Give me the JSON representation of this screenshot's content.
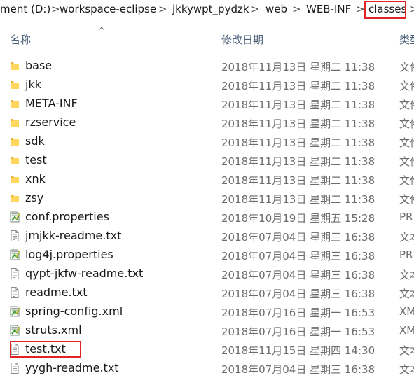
{
  "breadcrumb": [
    {
      "label": "ment (D:)"
    },
    {
      "label": "workspace-eclipse"
    },
    {
      "label": "jkkywpt_pydzk"
    },
    {
      "label": "web"
    },
    {
      "label": "WEB-INF"
    },
    {
      "label": "classes"
    }
  ],
  "breadcrumb_separator": ">",
  "columns": {
    "name": "名称",
    "date": "修改日期",
    "type": "类型",
    "sort_indicator": "^"
  },
  "highlight_color": "#e02424",
  "files": [
    {
      "name": "base",
      "modified": "2018年11月13日 星期二 11:38",
      "type": "文件",
      "icon": "folder-icon"
    },
    {
      "name": "jkk",
      "modified": "2018年11月13日 星期二 11:38",
      "type": "文件",
      "icon": "folder-icon"
    },
    {
      "name": "META-INF",
      "modified": "2018年11月13日 星期二 11:38",
      "type": "文件",
      "icon": "folder-icon"
    },
    {
      "name": "rzservice",
      "modified": "2018年11月13日 星期二 11:38",
      "type": "文件",
      "icon": "folder-icon"
    },
    {
      "name": "sdk",
      "modified": "2018年11月13日 星期二 11:38",
      "type": "文件",
      "icon": "folder-icon"
    },
    {
      "name": "test",
      "modified": "2018年11月13日 星期二 11:38",
      "type": "文件",
      "icon": "folder-icon"
    },
    {
      "name": "xnk",
      "modified": "2018年11月13日 星期二 11:38",
      "type": "文件",
      "icon": "folder-icon"
    },
    {
      "name": "zsy",
      "modified": "2018年11月13日 星期二 11:38",
      "type": "文件",
      "icon": "folder-icon"
    },
    {
      "name": "conf.properties",
      "modified": "2018年10月19日 星期五 15:28",
      "type": "PR",
      "icon": "config-file-icon"
    },
    {
      "name": "jmjkk-readme.txt",
      "modified": "2018年07月04日 星期三 16:38",
      "type": "文本",
      "icon": "text-file-icon"
    },
    {
      "name": "log4j.properties",
      "modified": "2018年07月04日 星期三 16:38",
      "type": "PR",
      "icon": "config-file-icon"
    },
    {
      "name": "qypt-jkfw-readme.txt",
      "modified": "2018年07月04日 星期三 16:38",
      "type": "文本",
      "icon": "text-file-icon"
    },
    {
      "name": "readme.txt",
      "modified": "2018年07月04日 星期三 16:38",
      "type": "文本",
      "icon": "text-file-icon"
    },
    {
      "name": "spring-config.xml",
      "modified": "2018年07月16日 星期一 16:53",
      "type": "XM",
      "icon": "config-file-icon"
    },
    {
      "name": "struts.xml",
      "modified": "2018年07月16日 星期一 16:53",
      "type": "XM",
      "icon": "config-file-icon"
    },
    {
      "name": "test.txt",
      "modified": "2018年11月15日 星期四 14:30",
      "type": "文本",
      "icon": "text-file-icon"
    },
    {
      "name": "yygh-readme.txt",
      "modified": "2018年07月04日 星期三 16:38",
      "type": "文本",
      "icon": "text-file-icon"
    }
  ]
}
